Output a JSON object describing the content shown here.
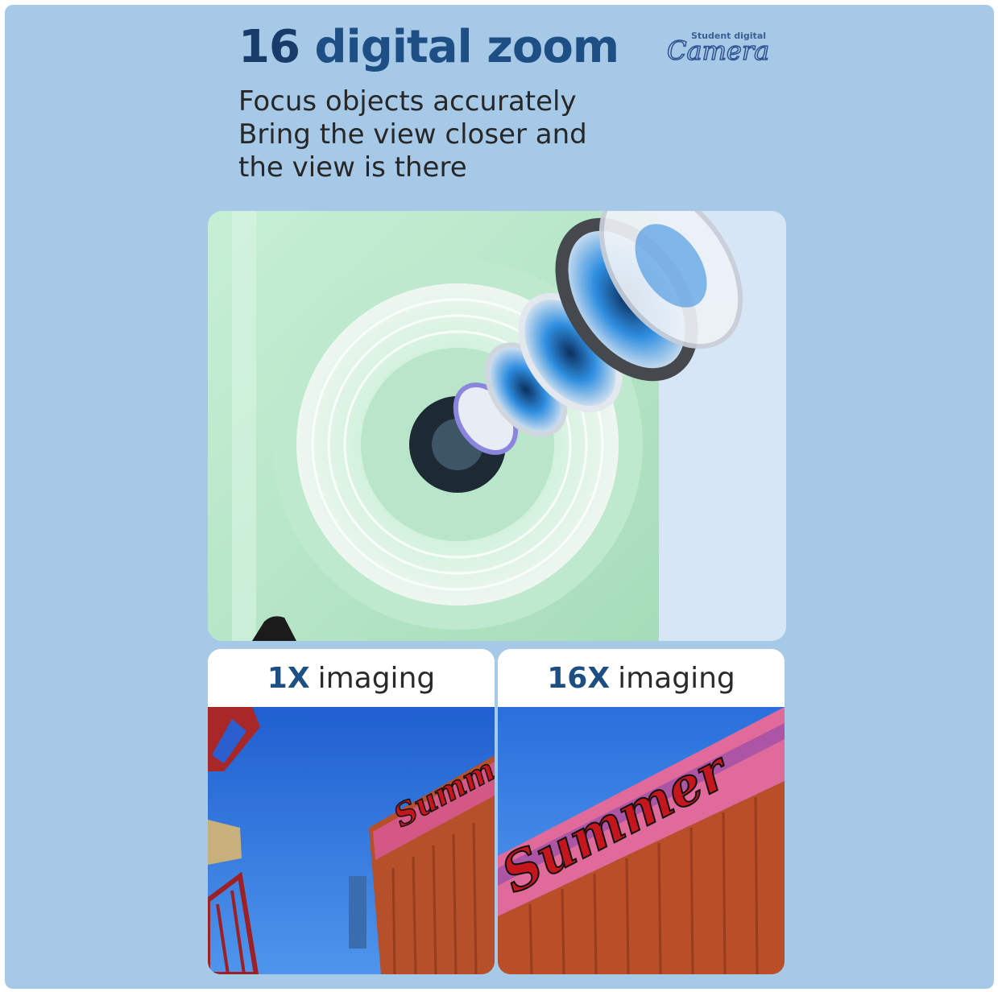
{
  "header": {
    "title_number": "16",
    "title_text": "digital zoom",
    "subtitle_lines": [
      "Focus objects accurately",
      "Bring the view closer and",
      "the view is there"
    ]
  },
  "logo": {
    "small_text": "Student digital",
    "big_text": "Camera"
  },
  "comparison": [
    {
      "zoom": "1X",
      "label": "imaging",
      "sign_text": "Summ"
    },
    {
      "zoom": "16X",
      "label": "imaging",
      "sign_text": "Summer"
    }
  ],
  "colors": {
    "background": "#a7c9e8",
    "accent": "#1d4f85",
    "camera_body": "#b4e4c4"
  }
}
